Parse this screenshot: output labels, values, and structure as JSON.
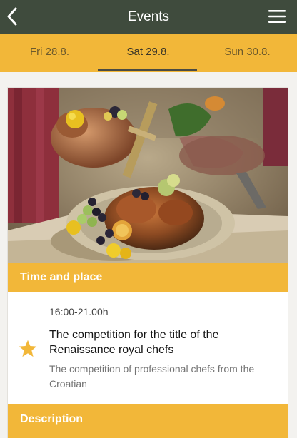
{
  "header": {
    "title": "Events",
    "back_icon": "chevron-left-icon",
    "menu_icon": "hamburger-menu-icon",
    "background_color": "#3f4b3d"
  },
  "day_tabs": [
    {
      "label": "Fri 28.8.",
      "selected": false
    },
    {
      "label": "Sat 29.8.",
      "selected": true
    },
    {
      "label": "Sun 30.8.",
      "selected": false
    }
  ],
  "accent_color": "#f2b739",
  "event": {
    "time_and_place_heading": "Time and place",
    "time": "16:00-21.00h",
    "title": "The competition for the title of the Renaissance royal chefs",
    "description": "The competition of professional chefs from the Croatian",
    "description_heading": "Description",
    "favorite_icon": "star-icon",
    "favorite_color": "#f2b739"
  }
}
